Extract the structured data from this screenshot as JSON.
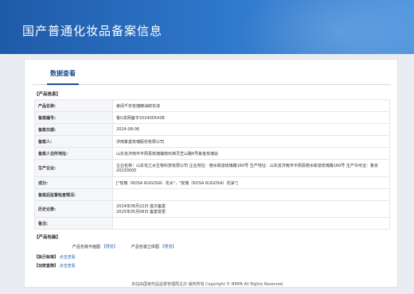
{
  "banner": {
    "title": "国产普通化妆品备案信息"
  },
  "tabs": [
    {
      "label": "数据查看"
    }
  ],
  "product_info": {
    "section_title": "【产品信息】",
    "rows": [
      {
        "key": "产品名称:",
        "value": [
          "姜阅千年玫瑰精油鲜花液"
        ]
      },
      {
        "key": "备案编号:",
        "value": [
          "鲁G妆网备字2024005438"
        ]
      },
      {
        "key": "备案日期:",
        "value": [
          "2024-08-06"
        ]
      },
      {
        "key": "备案人:",
        "value": [
          "济南紫金玫瑰股份有限公司"
        ]
      },
      {
        "key": "备案人住所地址:",
        "value": [
          "山东省济南市平阴县玫瑰镇南石峡灵芝山路6号紫金玫瑰谷"
        ]
      },
      {
        "key": "生产企业:",
        "value": [
          "企业名称：山东花之水生物科技有限公司 企业地址：德水街道玫瑰路160号 生产地址：山东省济南市平阴县德水街道玫瑰路160号 生产许可证：鲁妆20230005"
        ]
      },
      {
        "key": "成分:",
        "value": [
          "[\"玫瑰（ROSA RUGOSA）花水\"，\"玫瑰（ROSA RUGOSA）花油\"]"
        ]
      },
      {
        "key": "备案后监督检查情况:",
        "value": [
          ""
        ]
      },
      {
        "key": "历史记录:",
        "value": [
          "2024年08月22日 首次备案",
          "2025年05月06日 备案变更"
        ]
      },
      {
        "key": "备注:",
        "value": [
          ""
        ]
      }
    ]
  },
  "packaging": {
    "section_title": "【产品包装】",
    "flat_label": "产品包装平面图",
    "flat_link": "【预览】",
    "stereo_label": "产品包装立体图",
    "stereo_link": "【预览】"
  },
  "standard": {
    "label": "【执行标准】",
    "link": "点击查看"
  },
  "efficacy": {
    "label": "【功效宣称】",
    "link": "点击查看"
  },
  "footer": {
    "text": "本站由国家药品监督管理局主办 版权所有 Copyright © NMPA All Rights Reserved"
  },
  "colors": {
    "banner": "#2f78cc",
    "accent": "#1d4f91",
    "link": "#2a62b8"
  }
}
